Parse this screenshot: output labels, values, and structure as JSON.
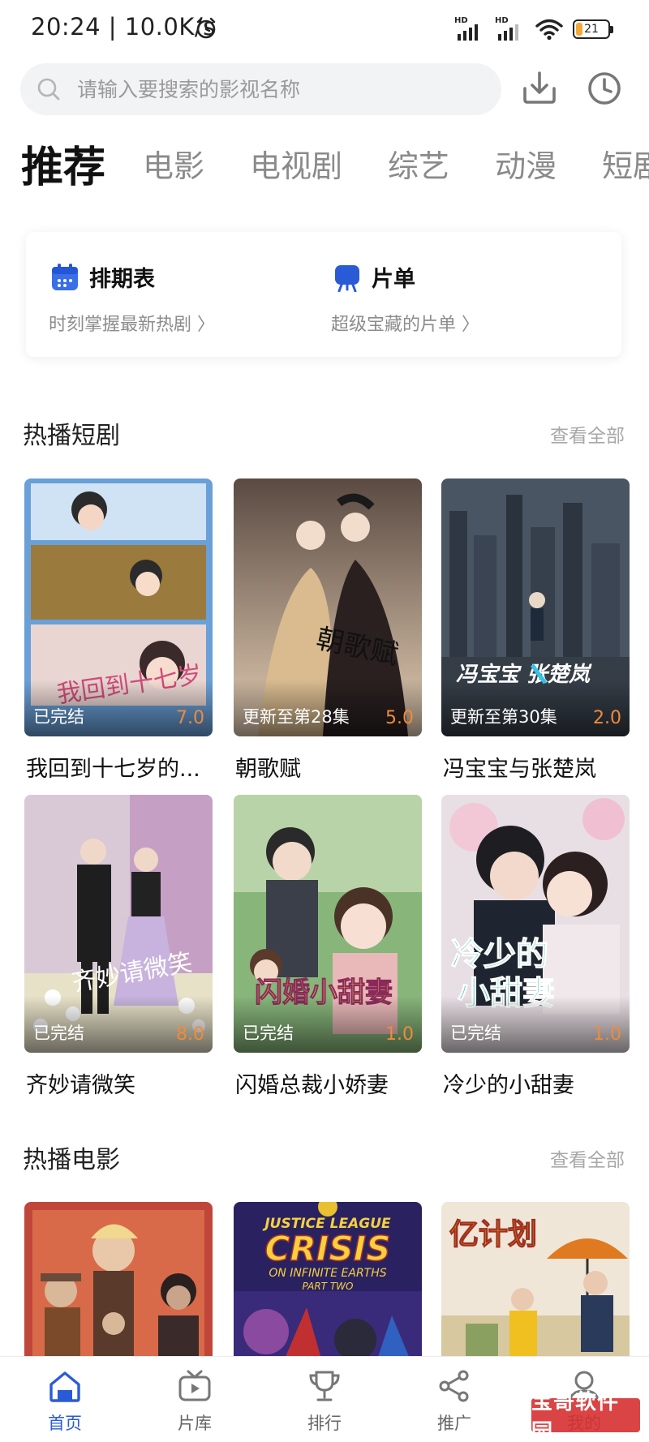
{
  "status_bar": {
    "time_speed": "20:24 | 10.0K/s",
    "battery_level": "21",
    "battery_fraction": 0.21,
    "signal_label": "HD",
    "icons": [
      "alarm-icon",
      "signal-icon",
      "signal-icon",
      "wifi-icon",
      "battery-icon"
    ]
  },
  "search": {
    "placeholder": "请输入要搜索的影视名称",
    "icons": [
      "search-icon",
      "download-icon",
      "history-icon"
    ]
  },
  "tabs": [
    "推荐",
    "电影",
    "电视剧",
    "综艺",
    "动漫",
    "短剧"
  ],
  "features": [
    {
      "title": "排期表",
      "subtitle": "时刻掌握最新热剧 〉",
      "icon": "calendar-icon",
      "color": "#3a6fe8"
    },
    {
      "title": "片单",
      "subtitle": "超级宝藏的片单 〉",
      "icon": "board-icon",
      "color": "#2a5bd7"
    }
  ],
  "short_drama": {
    "title": "热播短剧",
    "view_all": "查看全部",
    "items": [
      {
        "name": "我回到十七岁的...",
        "status": "已完结",
        "score": "7.0"
      },
      {
        "name": "朝歌赋",
        "status": "更新至第28集",
        "score": "5.0"
      },
      {
        "name": "冯宝宝与张楚岚",
        "status": "更新至第30集",
        "score": "2.0"
      },
      {
        "name": "齐妙请微笑",
        "status": "已完结",
        "score": "8.0"
      },
      {
        "name": "闪婚总裁小娇妻",
        "status": "已完结",
        "score": "1.0"
      },
      {
        "name": "冷少的小甜妻",
        "status": "已完结",
        "score": "1.0"
      }
    ]
  },
  "hot_movies": {
    "title": "热播电影",
    "view_all": "查看全部"
  },
  "bottom_nav": [
    {
      "label": "首页",
      "icon": "home-icon",
      "active": true
    },
    {
      "label": "片库",
      "icon": "tv-icon",
      "active": false
    },
    {
      "label": "排行",
      "icon": "trophy-icon",
      "active": false
    },
    {
      "label": "推广",
      "icon": "share-icon",
      "active": false
    },
    {
      "label": "我的",
      "icon": "user-icon",
      "active": false
    }
  ],
  "watermark": "宝哥软件园",
  "colors": {
    "accent": "#2a5bd7",
    "score": "#f08a3c",
    "tab_inactive": "#8a8a8a"
  }
}
